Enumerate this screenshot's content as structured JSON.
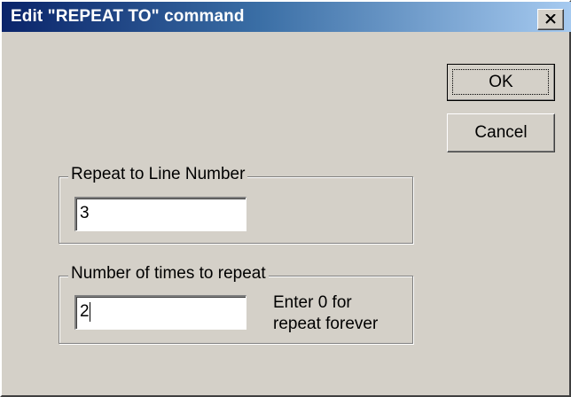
{
  "dialog": {
    "title": "Edit \"REPEAT TO\" command",
    "close_icon": "close-icon",
    "ok_label": "OK",
    "cancel_label": "Cancel"
  },
  "line_group": {
    "label": "Repeat to Line Number",
    "value": "3"
  },
  "times_group": {
    "label": "Number of times to repeat",
    "value": "2",
    "hint_line1": "Enter 0 for",
    "hint_line2": "repeat forever"
  },
  "colors": {
    "title_start": "#0a246a",
    "title_end": "#a6caf0",
    "face": "#d4d0c8"
  }
}
